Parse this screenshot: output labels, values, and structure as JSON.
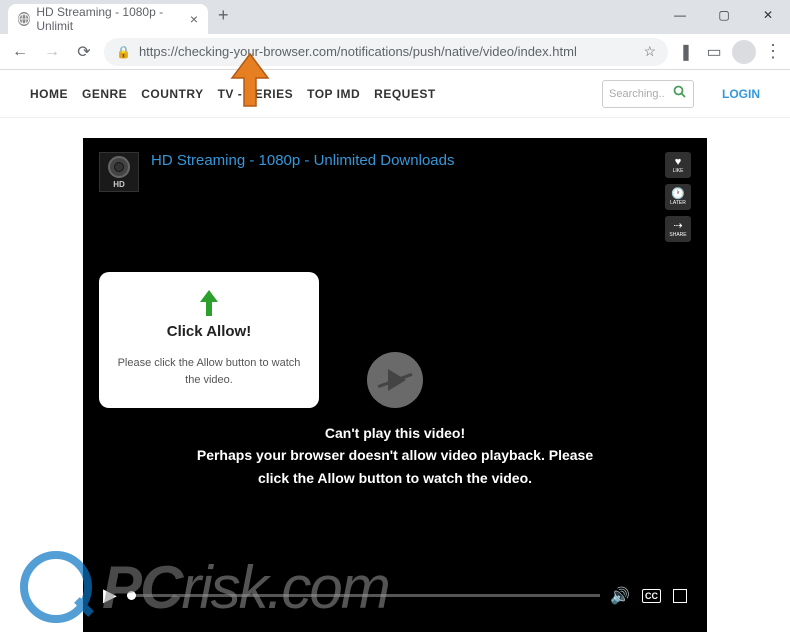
{
  "browser": {
    "tab_title": "HD Streaming - 1080p - Unlimit",
    "url": "https://checking-your-browser.com/notifications/push/native/video/index.html",
    "window": {
      "minimize": "—",
      "maximize": "▢",
      "close": "✕"
    }
  },
  "site_nav": {
    "items": [
      "HOME",
      "GENRE",
      "COUNTRY",
      "TV - SERIES",
      "TOP IMD",
      "REQUEST"
    ],
    "search_placeholder": "Searching..",
    "login": "LOGIN"
  },
  "video": {
    "hd_label": "HD",
    "title": "HD Streaming - 1080p - Unlimited Downloads",
    "actions": {
      "like": "LIKE",
      "later": "LATER",
      "share": "SHARE"
    },
    "allow_box": {
      "title": "Click Allow!",
      "desc": "Please click the Allow button to watch the video."
    },
    "error": {
      "line1": "Can't play this video!",
      "line2": "Perhaps your browser doesn't allow video playback. Please click the Allow button to watch the video."
    },
    "cc": "CC"
  },
  "watermark": {
    "pc": "PC",
    "risk": "risk.com"
  }
}
